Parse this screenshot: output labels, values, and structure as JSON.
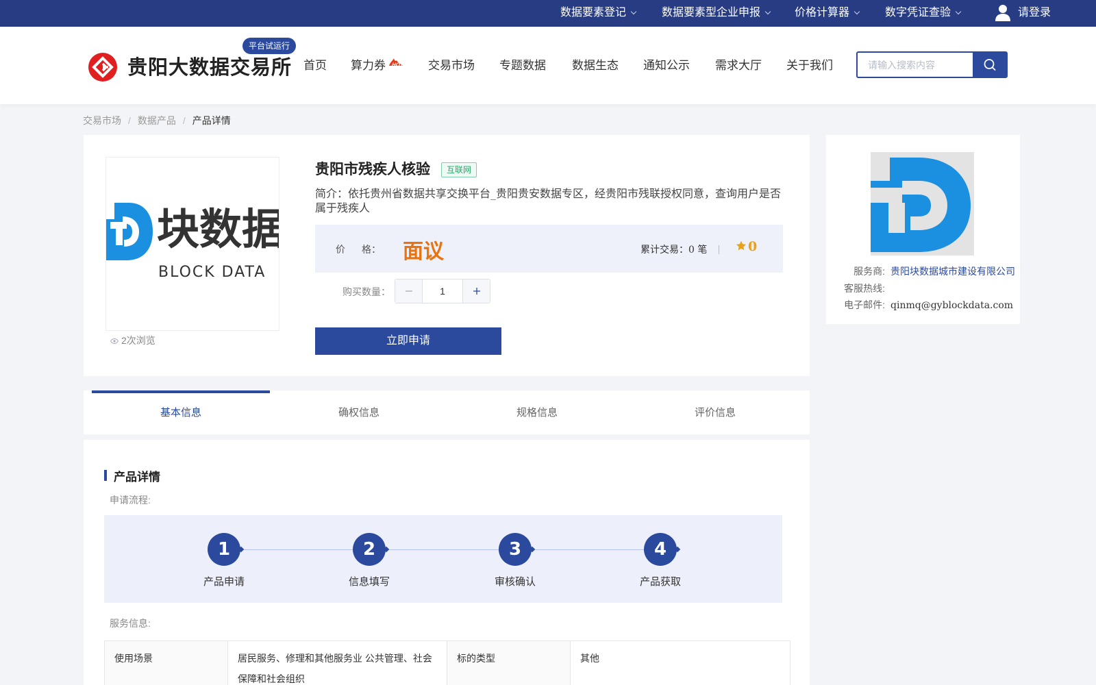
{
  "topbar": {
    "items": [
      {
        "label": "数据要素登记"
      },
      {
        "label": "数据要素型企业申报"
      },
      {
        "label": "价格计算器"
      },
      {
        "label": "数字凭证查验"
      }
    ],
    "login_label": "请登录"
  },
  "header": {
    "logo_text": "贵阳大数据交易所",
    "trial_badge": "平台试运行",
    "nav": [
      {
        "label": "首页"
      },
      {
        "label": "算力券"
      },
      {
        "label": "交易市场"
      },
      {
        "label": "专题数据"
      },
      {
        "label": "数据生态"
      },
      {
        "label": "通知公示"
      },
      {
        "label": "需求大厅"
      },
      {
        "label": "关于我们"
      }
    ],
    "hot_tag": "HOT",
    "search_placeholder": "请输入搜索内容"
  },
  "breadcrumb": [
    "交易市场",
    "数据产品",
    "产品详情"
  ],
  "product": {
    "title": "贵阳市残疾人核验",
    "tag": "互联网",
    "description": "简介：依托贵州省数据共享交换平台_贵阳贵安数据专区，经贵阳市残联授权同意，查询用户是否属于残疾人",
    "price_label_1": "价",
    "price_label_2": "格：",
    "price_value": "面议",
    "trades": "累计交易：0 笔",
    "rating": "0",
    "qty_label": "购买数量：",
    "qty_value": "1",
    "apply_label": "立即申请",
    "views": "2次浏览",
    "image_logo_text": "块数据",
    "image_logo_sub": "BLOCK DATA"
  },
  "vendor": {
    "provider_label": "服务商:",
    "provider": "贵阳块数据城市建设有限公司",
    "hotline_label": "客服热线:",
    "hotline": "",
    "email_label": "电子邮件:",
    "email": "qinmq@gyblockdata.com"
  },
  "tabs": [
    {
      "label": "基本信息",
      "active": true
    },
    {
      "label": "确权信息",
      "active": false
    },
    {
      "label": "规格信息",
      "active": false
    },
    {
      "label": "评价信息",
      "active": false
    }
  ],
  "details": {
    "section_title": "产品详情",
    "process_label": "申请流程:",
    "steps": [
      {
        "num": "1",
        "label": "产品申请"
      },
      {
        "num": "2",
        "label": "信息填写"
      },
      {
        "num": "3",
        "label": "审核确认"
      },
      {
        "num": "4",
        "label": "产品获取"
      }
    ],
    "service_label": "服务信息:",
    "table": [
      [
        "使用场景",
        "居民服务、修理和其他服务业 公共管理、社会保障和社会组织",
        "标的类型",
        "其他"
      ]
    ]
  },
  "colors": {
    "primary": "#2b4a9e",
    "topbar": "#283c84",
    "price": "#e8730f",
    "logo_red": "#e02020",
    "brand_blue": "#1b8fe0"
  }
}
